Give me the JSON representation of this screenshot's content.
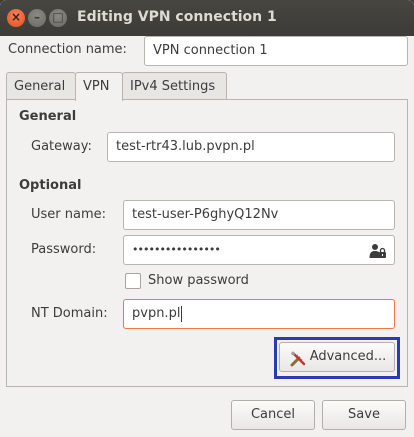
{
  "window": {
    "title": "Editing VPN connection 1",
    "close_glyph": "×",
    "minimize_glyph": "–",
    "maximize_glyph": "□"
  },
  "connection_name": {
    "label": "Connection name:",
    "value": "VPN connection 1"
  },
  "tabs": [
    {
      "label": "General",
      "active": false
    },
    {
      "label": "VPN",
      "active": true
    },
    {
      "label": "IPv4 Settings",
      "active": false
    }
  ],
  "vpn": {
    "general_heading": "General",
    "gateway_label": "Gateway:",
    "gateway_value": "test-rtr43.lub.pvpn.pl",
    "optional_heading": "Optional",
    "username_label": "User name:",
    "username_value": "test-user-P6ghyQ12Nv",
    "password_label": "Password:",
    "password_value": "••••••••••••••••",
    "password_icon": "user-lock-icon",
    "show_password_label": "Show password",
    "show_password_checked": false,
    "nt_domain_label": "NT Domain:",
    "nt_domain_value": "pvpn.pl",
    "advanced_label": "Advanced...",
    "advanced_icon": "tools-icon"
  },
  "buttons": {
    "cancel": "Cancel",
    "save": "Save"
  },
  "colors": {
    "accent_focus": "#f07746",
    "highlight_box": "#2a39b8",
    "close_button": "#e25019"
  }
}
